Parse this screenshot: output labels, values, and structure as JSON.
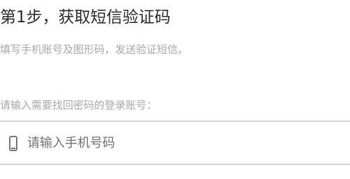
{
  "step": {
    "title": "第1步，获取短信验证码",
    "description": "填写手机账号及图形码，发送验证短信。"
  },
  "account": {
    "prompt": "请输入需要找回密码的登录账号：",
    "phone_field": {
      "icon": "mobile-phone-icon",
      "value": "",
      "placeholder": "请输入手机号码"
    }
  }
}
